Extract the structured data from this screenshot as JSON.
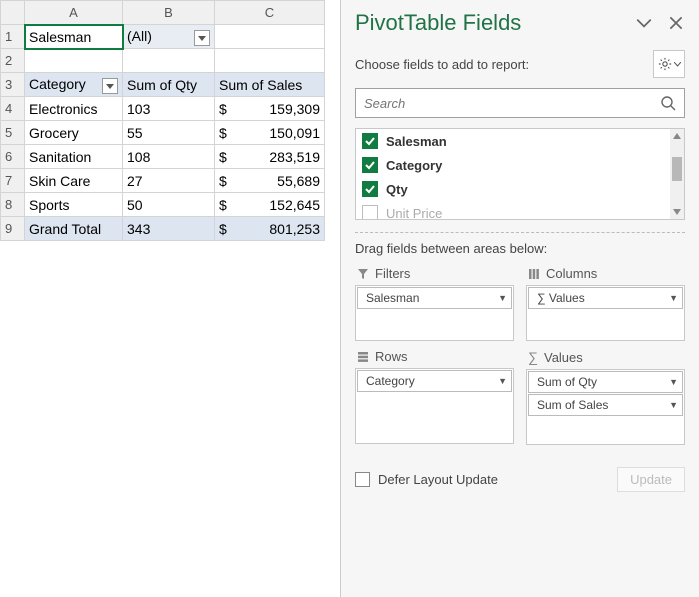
{
  "sheet": {
    "colHeaders": [
      "A",
      "B",
      "C"
    ],
    "rowHeaders": [
      "1",
      "2",
      "3",
      "4",
      "5",
      "6",
      "7",
      "8",
      "9"
    ],
    "filterLabel": "Salesman",
    "filterValue": "(All)",
    "headers": {
      "cat": "Category",
      "qty": "Sum of Qty",
      "sales": "Sum of Sales"
    },
    "rows": [
      {
        "cat": "Electronics",
        "qty": "103",
        "cur": "$",
        "sales": "159,309"
      },
      {
        "cat": "Grocery",
        "qty": "55",
        "cur": "$",
        "sales": "150,091"
      },
      {
        "cat": "Sanitation",
        "qty": "108",
        "cur": "$",
        "sales": "283,519"
      },
      {
        "cat": "Skin Care",
        "qty": "27",
        "cur": "$",
        "sales": "55,689"
      },
      {
        "cat": "Sports",
        "qty": "50",
        "cur": "$",
        "sales": "152,645"
      }
    ],
    "grand": {
      "label": "Grand Total",
      "qty": "343",
      "cur": "$",
      "sales": "801,253"
    }
  },
  "panel": {
    "title": "PivotTable Fields",
    "chooseLabel": "Choose fields to add to report:",
    "searchPlaceholder": "Search",
    "fields": [
      {
        "name": "Salesman",
        "checked": true
      },
      {
        "name": "Category",
        "checked": true
      },
      {
        "name": "Qty",
        "checked": true
      },
      {
        "name": "Unit Price",
        "checked": false
      }
    ],
    "dragLabel": "Drag fields between areas below:",
    "areas": {
      "filters": {
        "label": "Filters",
        "items": [
          "Salesman"
        ]
      },
      "columns": {
        "label": "Columns",
        "items": [
          "∑  Values"
        ]
      },
      "rows": {
        "label": "Rows",
        "items": [
          "Category"
        ]
      },
      "values": {
        "label": "Values",
        "items": [
          "Sum of Qty",
          "Sum of Sales"
        ]
      }
    },
    "deferLabel": "Defer Layout Update",
    "updateLabel": "Update"
  }
}
